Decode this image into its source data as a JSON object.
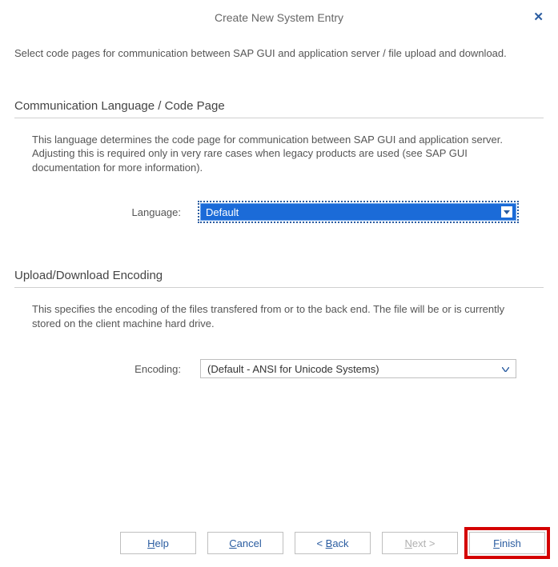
{
  "dialog": {
    "title": "Create New System Entry",
    "intro": "Select code pages for communication between SAP GUI and application server / file upload and download."
  },
  "section1": {
    "heading": "Communication Language / Code Page",
    "desc": "This language determines the code page for communication between SAP GUI and application server. Adjusting this is required only in very rare cases when legacy products are used (see SAP GUI documentation for more information).",
    "label": "Language:",
    "value": "Default"
  },
  "section2": {
    "heading": "Upload/Download Encoding",
    "desc": "This specifies the encoding of the files transfered from or to the back end. The file will be or is currently stored on the client machine hard drive.",
    "label": "Encoding:",
    "value": "(Default - ANSI for Unicode Systems)"
  },
  "buttons": {
    "help_u": "H",
    "help_rest": "elp",
    "cancel_u": "C",
    "cancel_rest": "ancel",
    "back_prefix": "< ",
    "back_u": "B",
    "back_rest": "ack",
    "next_u": "N",
    "next_rest": "ext >",
    "finish_u": "F",
    "finish_rest": "inish"
  }
}
